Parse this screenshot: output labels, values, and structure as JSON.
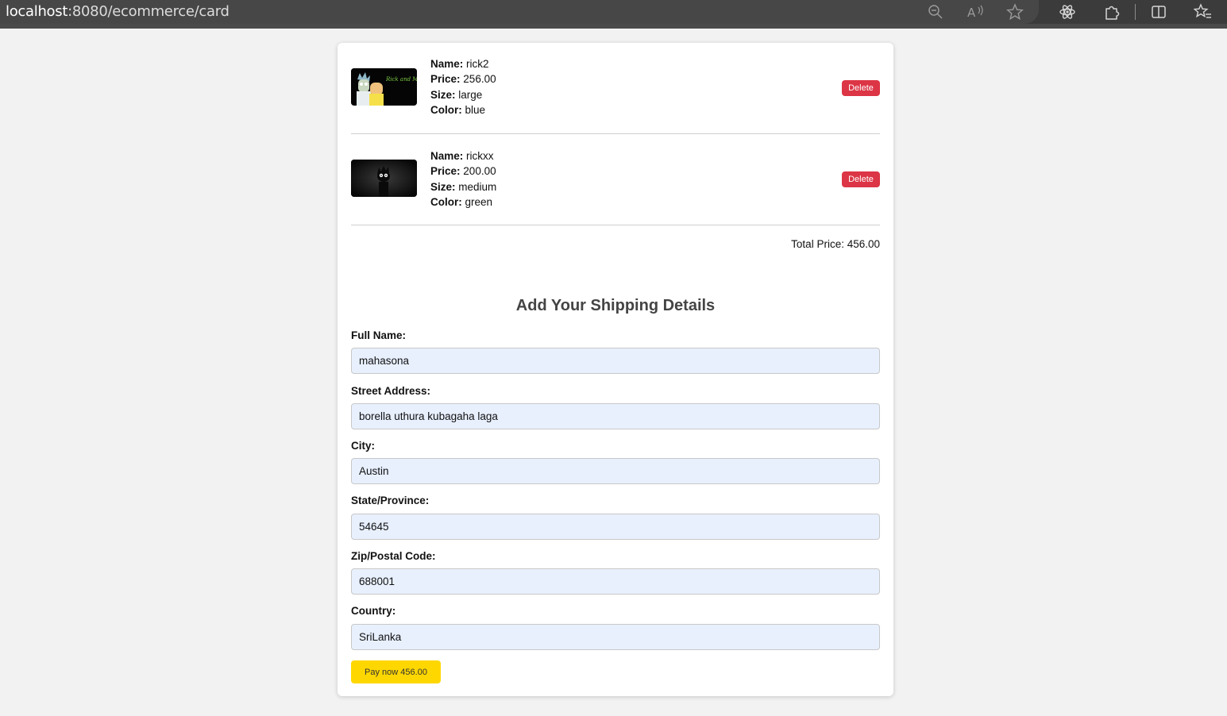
{
  "browser": {
    "url_host": "localhost",
    "url_rest": ":8080/ecommerce/card"
  },
  "cart": {
    "items": [
      {
        "name_label": "Name:",
        "name": "rick2",
        "price_label": "Price:",
        "price": "256.00",
        "size_label": "Size:",
        "size": "large",
        "color_label": "Color:",
        "color": "blue",
        "delete_label": "Delete",
        "thumb_icon": "rick-and-morty-image",
        "thumb_text": "Rick and Morty"
      },
      {
        "name_label": "Name:",
        "name": "rickxx",
        "price_label": "Price:",
        "price": "200.00",
        "size_label": "Size:",
        "size": "medium",
        "color_label": "Color:",
        "color": "green",
        "delete_label": "Delete",
        "thumb_icon": "dark-rick-image"
      }
    ],
    "total_text": "Total Price: 456.00"
  },
  "shipping": {
    "title": "Add Your Shipping Details",
    "fields": [
      {
        "label": "Full Name:",
        "value": "mahasona"
      },
      {
        "label": "Street Address:",
        "value": "borella uthura kubagaha laga"
      },
      {
        "label": "City:",
        "value": "Austin"
      },
      {
        "label": "State/Province:",
        "value": "54645"
      },
      {
        "label": "Zip/Postal Code:",
        "value": "688001"
      },
      {
        "label": "Country:",
        "value": "SriLanka"
      }
    ],
    "pay_label": "Pay now 456.00"
  },
  "colors": {
    "delete": "#dc3545",
    "pay": "#ffd700",
    "input_bg": "#e8f0fe"
  }
}
